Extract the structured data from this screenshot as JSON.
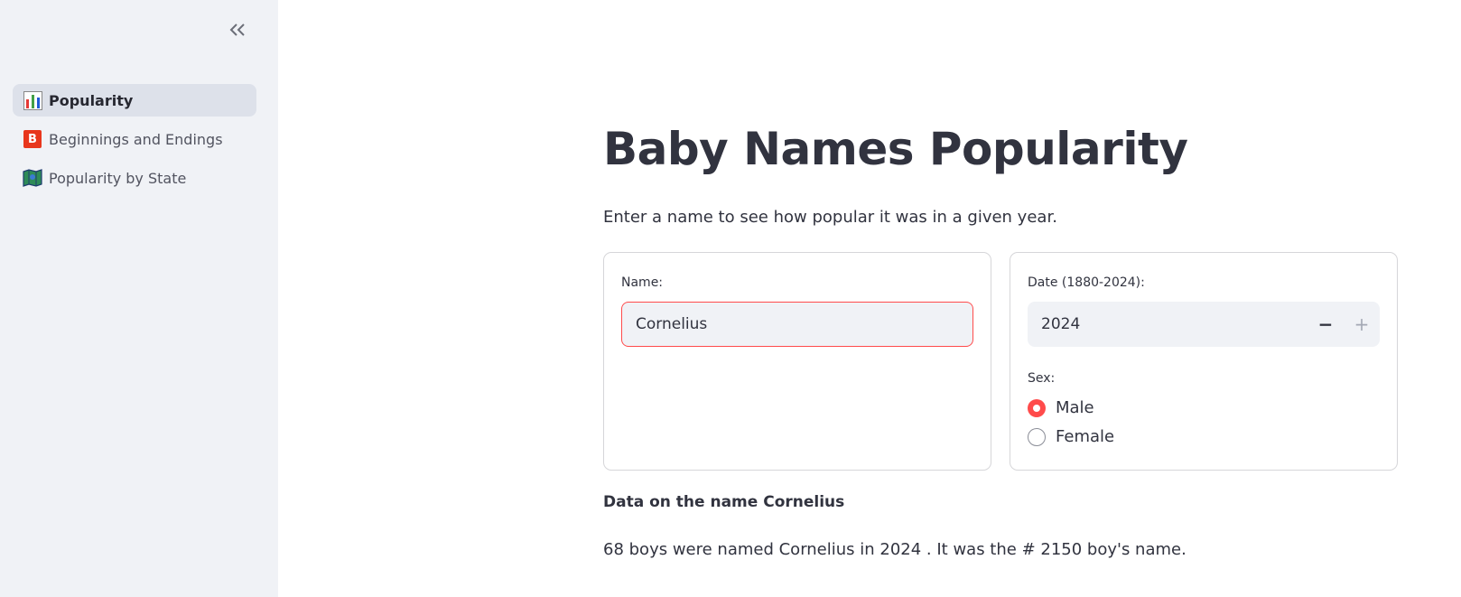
{
  "sidebar": {
    "collapse_icon": "double-chevron-left-icon",
    "items": [
      {
        "label": "Popularity",
        "icon": "bar-chart-icon",
        "active": true
      },
      {
        "label": "Beginnings and Endings",
        "icon": "b-badge-icon",
        "icon_text": "B",
        "active": false
      },
      {
        "label": "Popularity by State",
        "icon": "map-icon",
        "active": false
      }
    ]
  },
  "main": {
    "title": "Baby Names Popularity",
    "subtitle": "Enter a name to see how popular it was in a given year.",
    "name_field": {
      "label": "Name:",
      "value": "Cornelius"
    },
    "date_field": {
      "label": "Date (1880-2024):",
      "value": "2024",
      "minus": "−",
      "plus": "+"
    },
    "sex_field": {
      "label": "Sex:",
      "options": [
        {
          "label": "Male",
          "checked": true
        },
        {
          "label": "Female",
          "checked": false
        }
      ]
    },
    "data_heading": "Data on the name Cornelius",
    "result_text": "68 boys were named Cornelius in 2024 . It was the # 2150 boy's name."
  },
  "colors": {
    "accent": "#ff4b4b",
    "sidebar_bg": "#f0f2f6",
    "text": "#31333f"
  }
}
